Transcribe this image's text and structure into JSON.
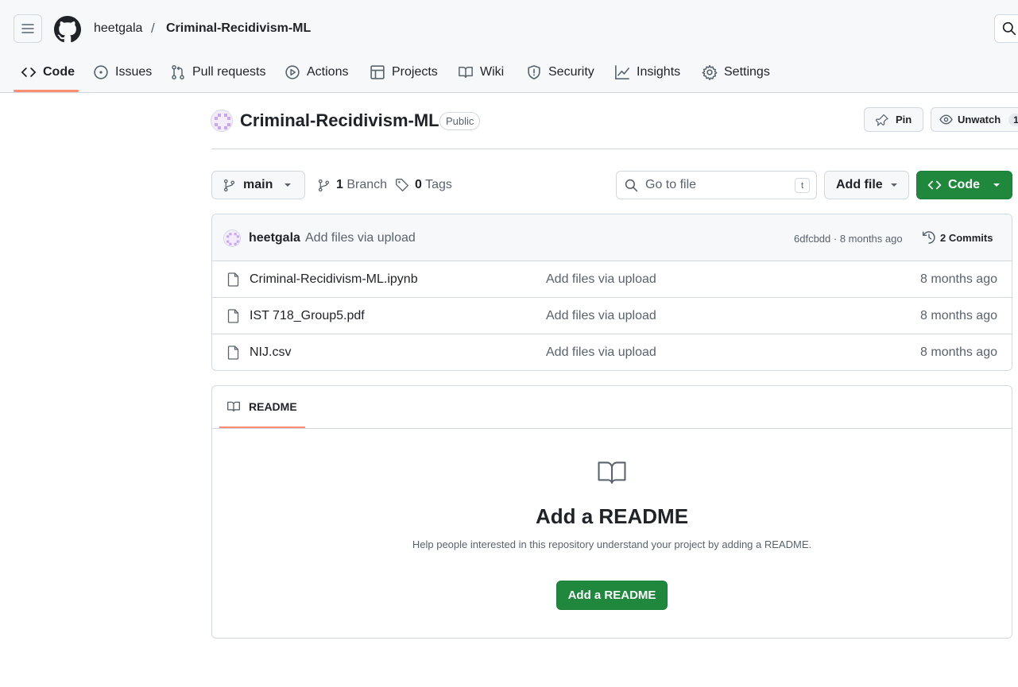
{
  "header": {
    "owner": "heetgala",
    "separator": "/",
    "repo": "Criminal-Recidivism-ML"
  },
  "nav": {
    "items": [
      {
        "label": "Code",
        "icon": "code-icon",
        "active": true
      },
      {
        "label": "Issues",
        "icon": "issue-opened-icon"
      },
      {
        "label": "Pull requests",
        "icon": "git-pull-request-icon"
      },
      {
        "label": "Actions",
        "icon": "play-icon"
      },
      {
        "label": "Projects",
        "icon": "table-icon"
      },
      {
        "label": "Wiki",
        "icon": "book-icon"
      },
      {
        "label": "Security",
        "icon": "shield-icon"
      },
      {
        "label": "Insights",
        "icon": "graph-icon"
      },
      {
        "label": "Settings",
        "icon": "gear-icon"
      }
    ]
  },
  "repo": {
    "title": "Criminal-Recidivism-ML",
    "visibility": "Public",
    "pin_label": "Pin",
    "watch_label": "Unwatch",
    "watch_count": "1"
  },
  "toolbar": {
    "branch": "main",
    "branch_count": "1",
    "branch_label": "Branch",
    "tag_count": "0",
    "tag_label": "Tags",
    "goto_placeholder": "Go to file",
    "goto_shortcut": "t",
    "add_file_label": "Add file",
    "code_label": "Code"
  },
  "commit": {
    "author": "heetgala",
    "message": "Add files via upload",
    "sha_time": "6dfcbdd · 8 months ago",
    "commits_label": "2 Commits"
  },
  "files": [
    {
      "name": "Criminal-Recidivism-ML.ipynb",
      "message": "Add files via upload",
      "time": "8 months ago"
    },
    {
      "name": "IST 718_Group5.pdf",
      "message": "Add files via upload",
      "time": "8 months ago"
    },
    {
      "name": "NIJ.csv",
      "message": "Add files via upload",
      "time": "8 months ago"
    }
  ],
  "readme": {
    "tab_label": "README",
    "heading": "Add a README",
    "description": "Help people interested in this repository understand your project by adding a README.",
    "button_label": "Add a README"
  },
  "colors": {
    "accent_underline": "#fd8c73",
    "primary_button": "#1f883d",
    "border": "#d1d9e0",
    "muted_text": "#59636e"
  }
}
